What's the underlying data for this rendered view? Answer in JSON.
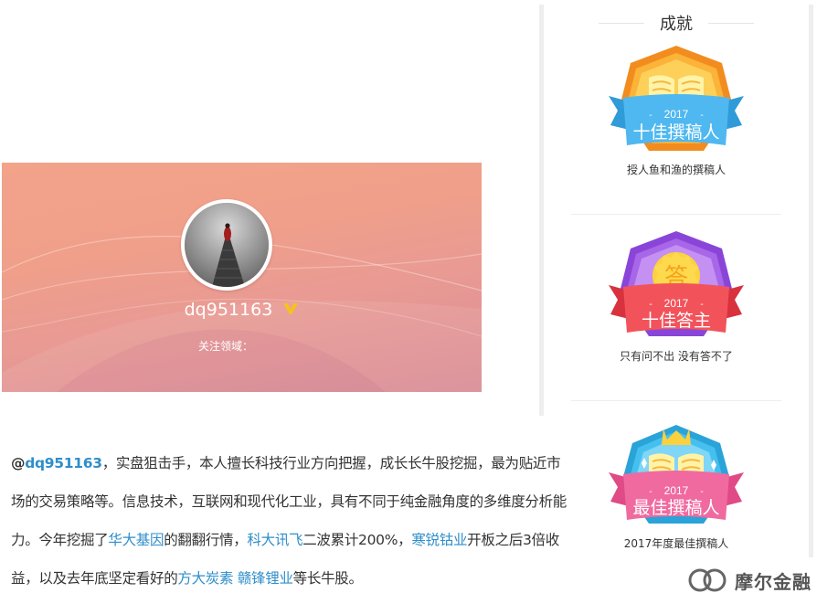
{
  "profile": {
    "username": "dq951163",
    "focus_label": "关注领域：",
    "banner_colors": {
      "top": "#f3a38a",
      "bottom": "#d98c95"
    }
  },
  "bio": {
    "at": "@",
    "handle": "dq951163",
    "seg1": "，实盘狙击手，本人擅长科技行业方向把握，成长长牛股挖掘，最为贴近市场的交易策略等。信息技术，互联网和现代化工业，具有不同于纯金融角度的多维度分析能力。今年挖掘了",
    "link1": "华大基因",
    "seg2": "的翻翻行情，",
    "link2": "科大讯飞",
    "seg3": "二波累计200%，",
    "link3": "寒锐钴业",
    "seg4": "开板之后3倍收益，以及去年底坚定看好的",
    "link4": "方大炭素",
    "seg5": " ",
    "link5": "赣锋锂业",
    "seg6": "等长牛股。",
    "link_color": "#2f8ecb"
  },
  "achievements": {
    "title": "成就",
    "badges": [
      {
        "icon": "book-badge-icon",
        "year": "2017",
        "ribbon_text": "十佳撰稿人",
        "caption": "授人鱼和渔的撰稿人",
        "ribbon_color": "#4fb8f0",
        "shield_color": "#f5a623"
      },
      {
        "icon": "answer-badge-icon",
        "glyph": "答",
        "year": "2017",
        "ribbon_text": "十佳答主",
        "caption": "只有问不出 没有答不了",
        "ribbon_color": "#f2535b",
        "shield_color": "#a866e8"
      },
      {
        "icon": "crown-book-badge-icon",
        "year": "2017",
        "ribbon_text": "最佳撰稿人",
        "caption": "2017年度最佳撰稿人",
        "ribbon_color": "#f06aa0",
        "shield_color": "#38b8e8"
      }
    ]
  },
  "watermark": {
    "text": "摩尔金融"
  }
}
